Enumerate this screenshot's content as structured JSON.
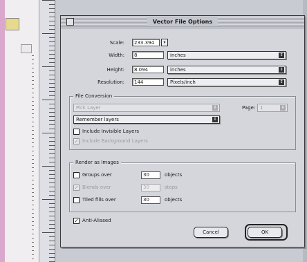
{
  "dialog": {
    "title": "Vector File Options",
    "scale": {
      "label": "Scale:",
      "value": "233.394",
      "dropdown_glyph": "▾"
    },
    "width": {
      "label": "Width:",
      "value": "8",
      "unit": "inches"
    },
    "height": {
      "label": "Height:",
      "value": "8.094",
      "unit": "inches"
    },
    "resolution": {
      "label": "Resolution:",
      "value": "144",
      "unit": "Pixels/inch"
    },
    "file_conversion": {
      "title": "File Conversion",
      "layer_select": "Pick Layer",
      "page_label": "Page:",
      "page_value": "1",
      "layers_select": "Remember layers",
      "include_invisible": {
        "label": "Include Invisible Layers",
        "checked": false
      },
      "include_background": {
        "label": "Include Background Layers",
        "checked": true,
        "disabled": true
      }
    },
    "render_as_images": {
      "title": "Render as Images",
      "groups": {
        "label": "Groups over",
        "value": "30",
        "unit": "objects",
        "checked": false
      },
      "blends": {
        "label": "Blends over",
        "value": "30",
        "unit": "steps",
        "checked": true,
        "disabled": true
      },
      "tiled_fills": {
        "label": "Tiled fills over",
        "value": "30",
        "unit": "objects",
        "checked": false
      }
    },
    "anti_aliased": {
      "label": "Anti-Aliased",
      "checked": true
    },
    "cancel_button": "Cancel",
    "ok_button": "OK",
    "check_glyph": "✓",
    "select_arrows": "⇕"
  }
}
